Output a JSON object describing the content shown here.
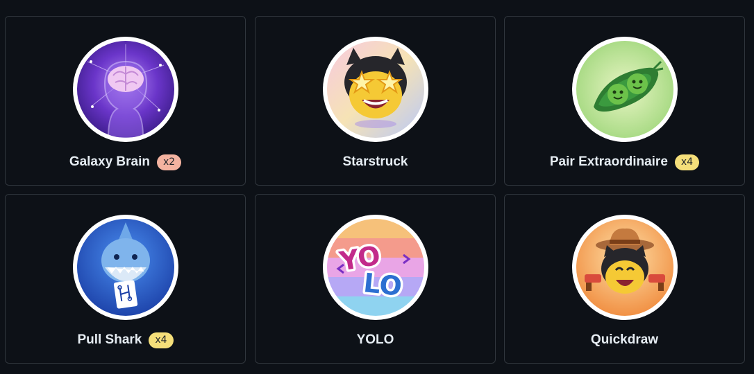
{
  "achievements": [
    {
      "name": "Galaxy Brain",
      "count": "x2",
      "count_color": "#f4b3a0",
      "icon": "galaxy-brain-icon"
    },
    {
      "name": "Starstruck",
      "count": null,
      "icon": "starstruck-icon"
    },
    {
      "name": "Pair Extraordinaire",
      "count": "x4",
      "count_color": "#f5df7a",
      "icon": "pair-extraordinaire-icon"
    },
    {
      "name": "Pull Shark",
      "count": "x4",
      "count_color": "#f5df7a",
      "icon": "pull-shark-icon"
    },
    {
      "name": "YOLO",
      "count": null,
      "icon": "yolo-icon",
      "art_text": "YOLO"
    },
    {
      "name": "Quickdraw",
      "count": null,
      "icon": "quickdraw-icon"
    }
  ],
  "colors": {
    "background": "#0d1117",
    "card_border": "#30363d",
    "text": "#e6edf3"
  }
}
